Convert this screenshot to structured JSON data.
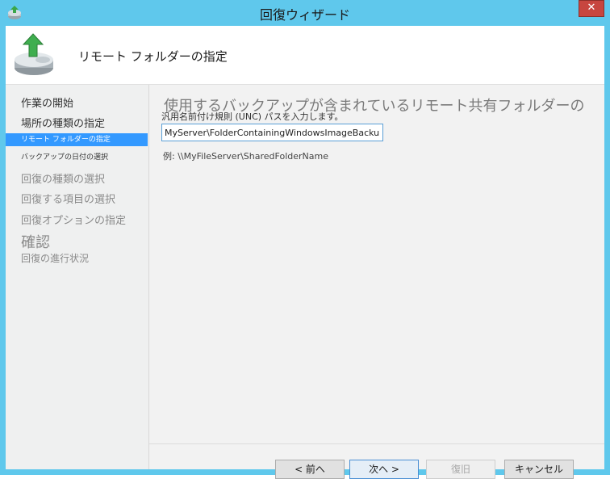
{
  "window": {
    "title": "回復ウィザード",
    "close_label": "✕"
  },
  "header": {
    "title": "リモート フォルダーの指定"
  },
  "nav": {
    "items": [
      {
        "label": "作業の開始"
      },
      {
        "label": "場所の種類の指定"
      },
      {
        "label": "リモート フォルダーの指定"
      },
      {
        "label": "バックアップの日付の選択"
      },
      {
        "label": "回復の種類の選択"
      },
      {
        "label": "回復する項目の選択"
      },
      {
        "label": "回復オプションの指定"
      },
      {
        "label": "確認"
      },
      {
        "label": "回復の進行状況"
      }
    ]
  },
  "main": {
    "heading": "使用するバックアップが含まれているリモート共有フォルダーの",
    "subheading": "汎用名前付け規則 (UNC) パスを入力します。",
    "unc_value": "MyServer\\FolderContainingWindowsImageBackup\\",
    "example": "例: \\\\MyFileServer\\SharedFolderName"
  },
  "buttons": {
    "back": "< 前へ",
    "next": "次へ >",
    "recover": "復旧",
    "cancel": "キャンセル"
  }
}
